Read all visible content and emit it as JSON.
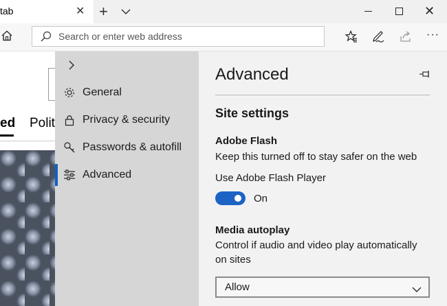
{
  "tab": {
    "title": "tab"
  },
  "address_bar": {
    "placeholder": "Search or enter web address"
  },
  "page_behind": {
    "tab_active": "ed",
    "tab_other": "Politi"
  },
  "settings_menu": {
    "items": [
      {
        "label": "General",
        "icon": "gear-icon"
      },
      {
        "label": "Privacy & security",
        "icon": "lock-icon"
      },
      {
        "label": "Passwords & autofill",
        "icon": "key-icon"
      },
      {
        "label": "Advanced",
        "icon": "sliders-icon",
        "active": true
      }
    ]
  },
  "advanced_panel": {
    "title": "Advanced",
    "site_settings_heading": "Site settings",
    "flash_heading": "Adobe Flash",
    "flash_description": "Keep this turned off to stay safer on the web",
    "flash_toggle_label": "Use Adobe Flash Player",
    "flash_toggle_state": "On",
    "media_heading": "Media autoplay",
    "media_description": "Control if audio and video play automatically on sites",
    "media_selected": "Allow"
  },
  "colors": {
    "accent": "#1d63c5",
    "menu_bg": "#d6d6d6",
    "panel_bg": "#f2f2f2"
  }
}
